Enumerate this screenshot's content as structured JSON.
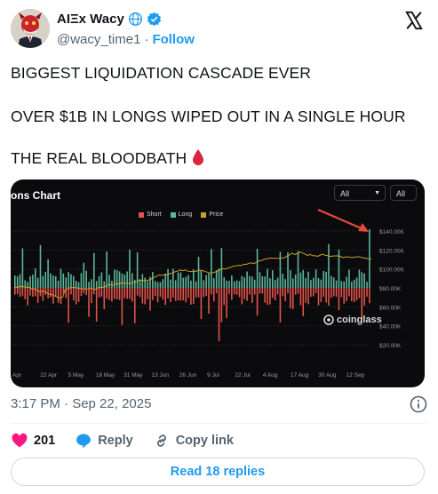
{
  "author": {
    "display_name": "AIΞx Wacy",
    "handle": "@wacy_time1",
    "separator": "·",
    "follow_label": "Follow"
  },
  "tweet": {
    "lines": [
      "BIGGEST LIQUIDATION CASCADE EVER",
      "OVER $1B IN LONGS WIPED OUT IN A SINGLE HOUR",
      "THE REAL BLOODBATH"
    ],
    "emoji": "drop-of-blood-icon",
    "timestamp": "3:17 PM · Sep 22, 2025"
  },
  "chart": {
    "title": "ons Chart",
    "dropdown_1": "All",
    "dropdown_2": "All",
    "watermark": "coinglass",
    "colors": {
      "short": "#e5534b",
      "long": "#5bb89a",
      "price": "#c9a02c",
      "arrow": "#e8493f",
      "background": "#0b0b0d"
    }
  },
  "chart_data": {
    "type": "bar",
    "series": [
      {
        "name": "Short"
      },
      {
        "name": "Long"
      },
      {
        "name": "Price"
      }
    ],
    "x_tick_labels": [
      "Apr",
      "22 Apr",
      "5 May",
      "18 May",
      "31 May",
      "13 Jun",
      "26 Jun",
      "9 Jul",
      "22 Jul",
      "4 Aug",
      "17 Aug",
      "30 Aug",
      "12 Sep"
    ],
    "y_tick_labels": [
      "$140.00K",
      "$120.00K",
      "$100.00K",
      "$80.00K",
      "$60.00K",
      "$40.00K",
      "$20.00K"
    ],
    "price_ylim": [
      20000,
      140000
    ],
    "grid": true,
    "legend_position": "top-center",
    "annotation": "red arrow pointing to final long liquidation spike"
  },
  "engagement": {
    "likes": "201",
    "reply_label": "Reply",
    "copy_link_label": "Copy link",
    "read_replies_label": "Read 18 replies"
  }
}
